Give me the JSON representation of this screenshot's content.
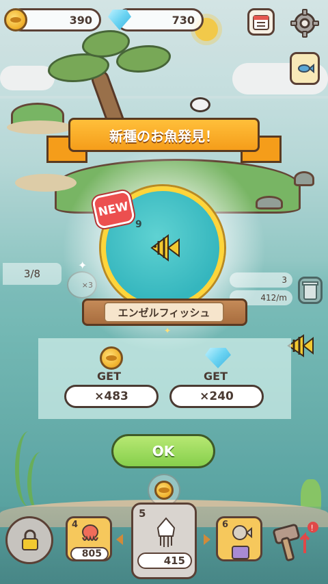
{
  "currency": {
    "coins": "390",
    "gems": "730"
  },
  "banner": {
    "title": "新種のお魚発見！"
  },
  "discovery": {
    "new_badge": "NEW",
    "fish_count": "9",
    "fish_name": "エンゼルフィッシュ"
  },
  "reward": {
    "coin_get": "GET",
    "gem_get": "GET",
    "coin_amount": "×483",
    "gem_amount": "×240"
  },
  "ok_label": "OK",
  "progress": "3/8",
  "stats": {
    "count": "3",
    "rate": "412/m",
    "left_badge": "×3"
  },
  "slots": [
    {
      "num": "4",
      "price": "805"
    },
    {
      "num": "5",
      "price": "415"
    },
    {
      "num": "6"
    }
  ],
  "colors": {
    "accent_green": "#86cf4c",
    "banner_orange": "#f59d1a",
    "coin_gold": "#f2b632",
    "gem_blue": "#6ad3f2",
    "new_red": "#ec4f4f"
  }
}
